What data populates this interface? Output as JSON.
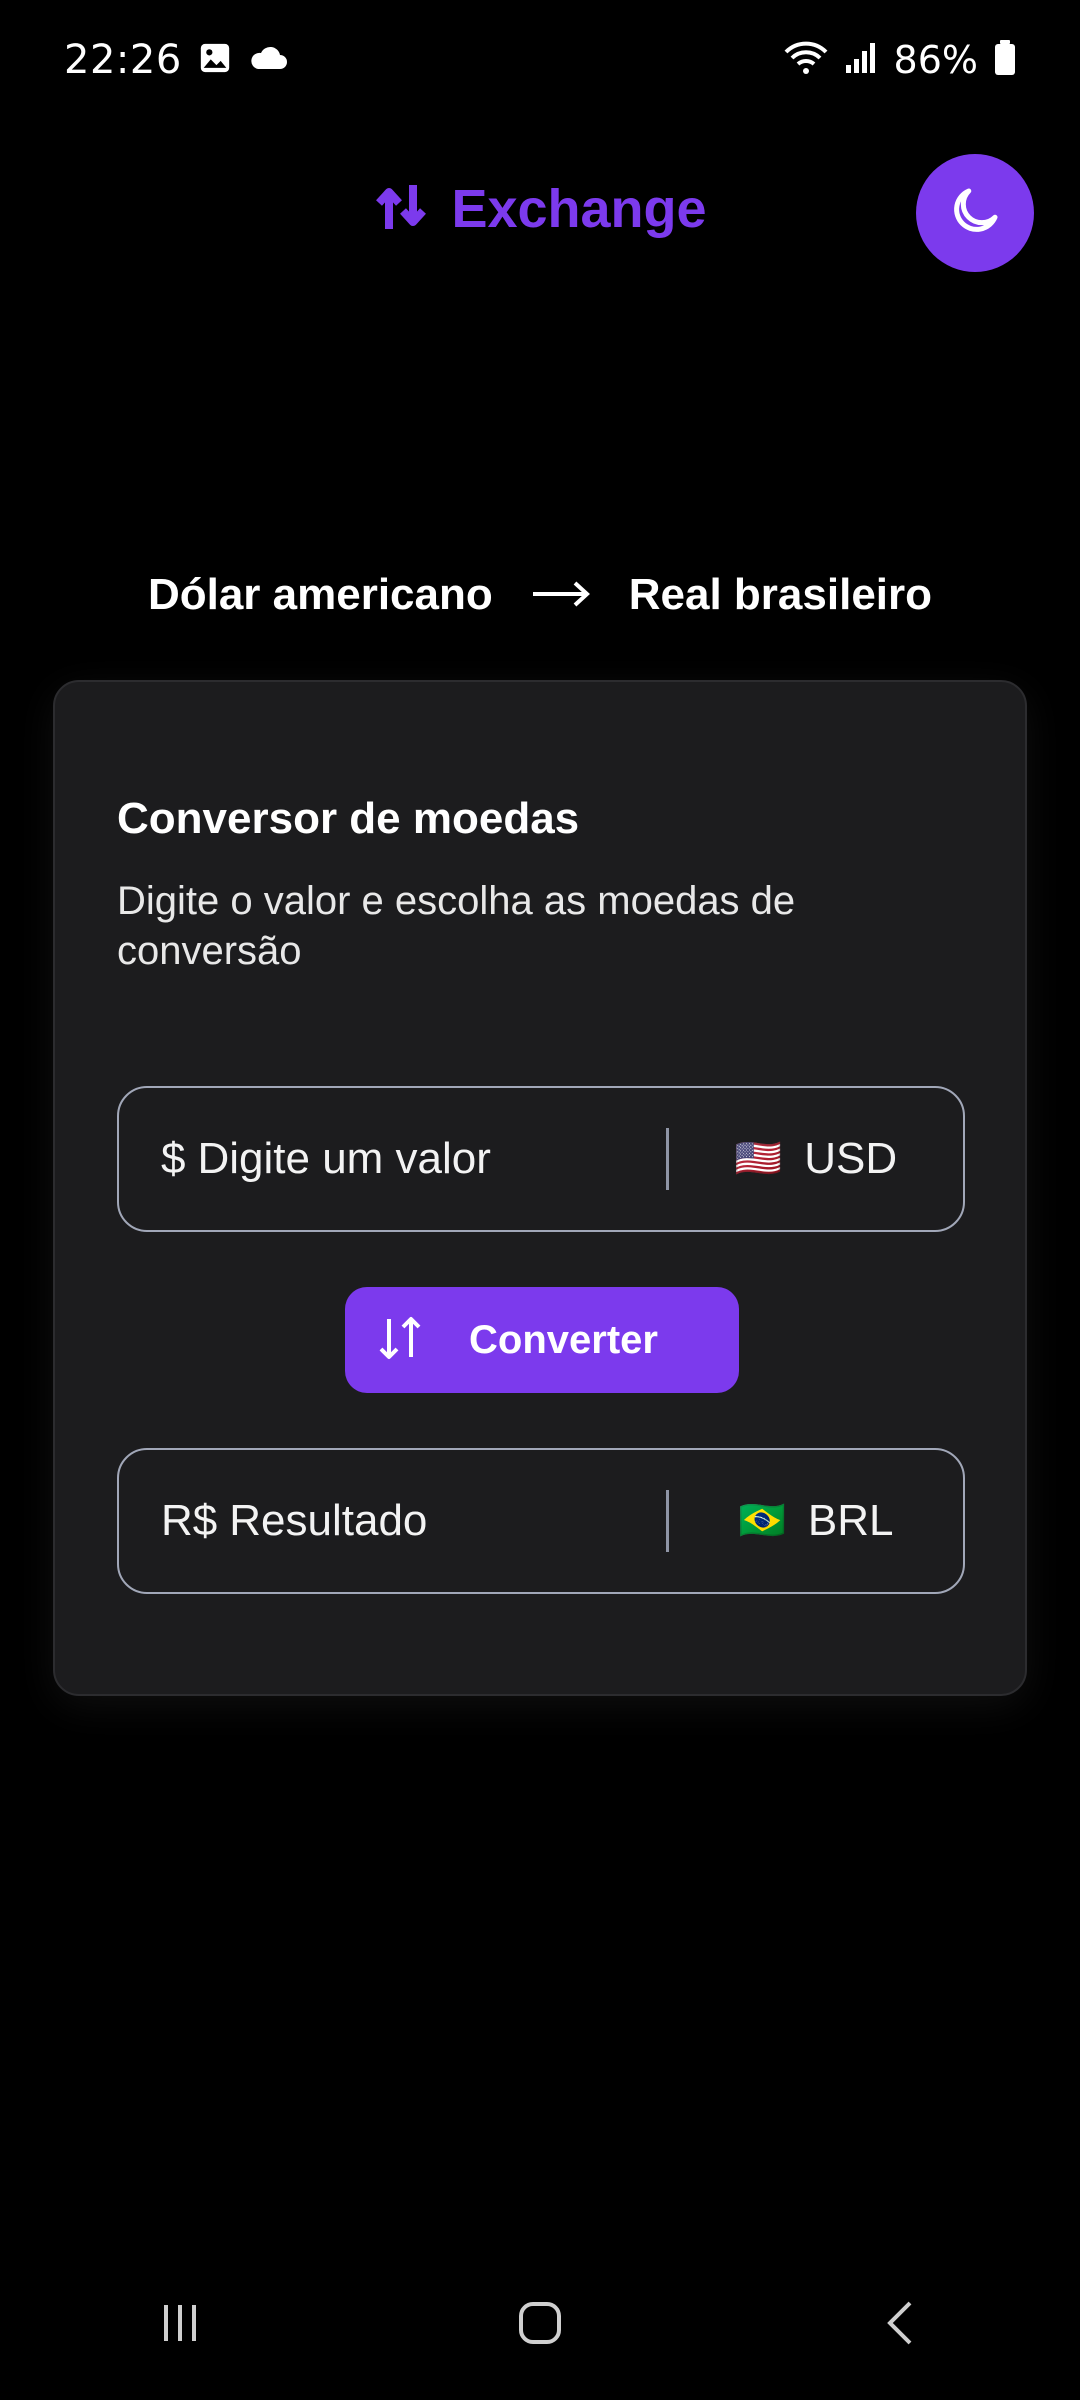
{
  "status_bar": {
    "time": "22:26",
    "battery": "86%"
  },
  "header": {
    "title": "Exchange",
    "accent_color": "#7c3aed",
    "theme_toggle_icon": "moon-icon"
  },
  "route": {
    "from": "Dólar americano",
    "to": "Real brasileiro"
  },
  "card": {
    "title": "Conversor de moedas",
    "subtitle": "Digite o valor e escolha as moedas de conversão",
    "input_field": {
      "prefix": "$",
      "placeholder": "Digite um valor",
      "currency_flag": "🇺🇸",
      "currency_code": "USD"
    },
    "convert_button": {
      "label": "Converter"
    },
    "result_field": {
      "prefix": "R$",
      "placeholder": "Resultado",
      "currency_flag": "🇧🇷",
      "currency_code": "BRL"
    }
  }
}
